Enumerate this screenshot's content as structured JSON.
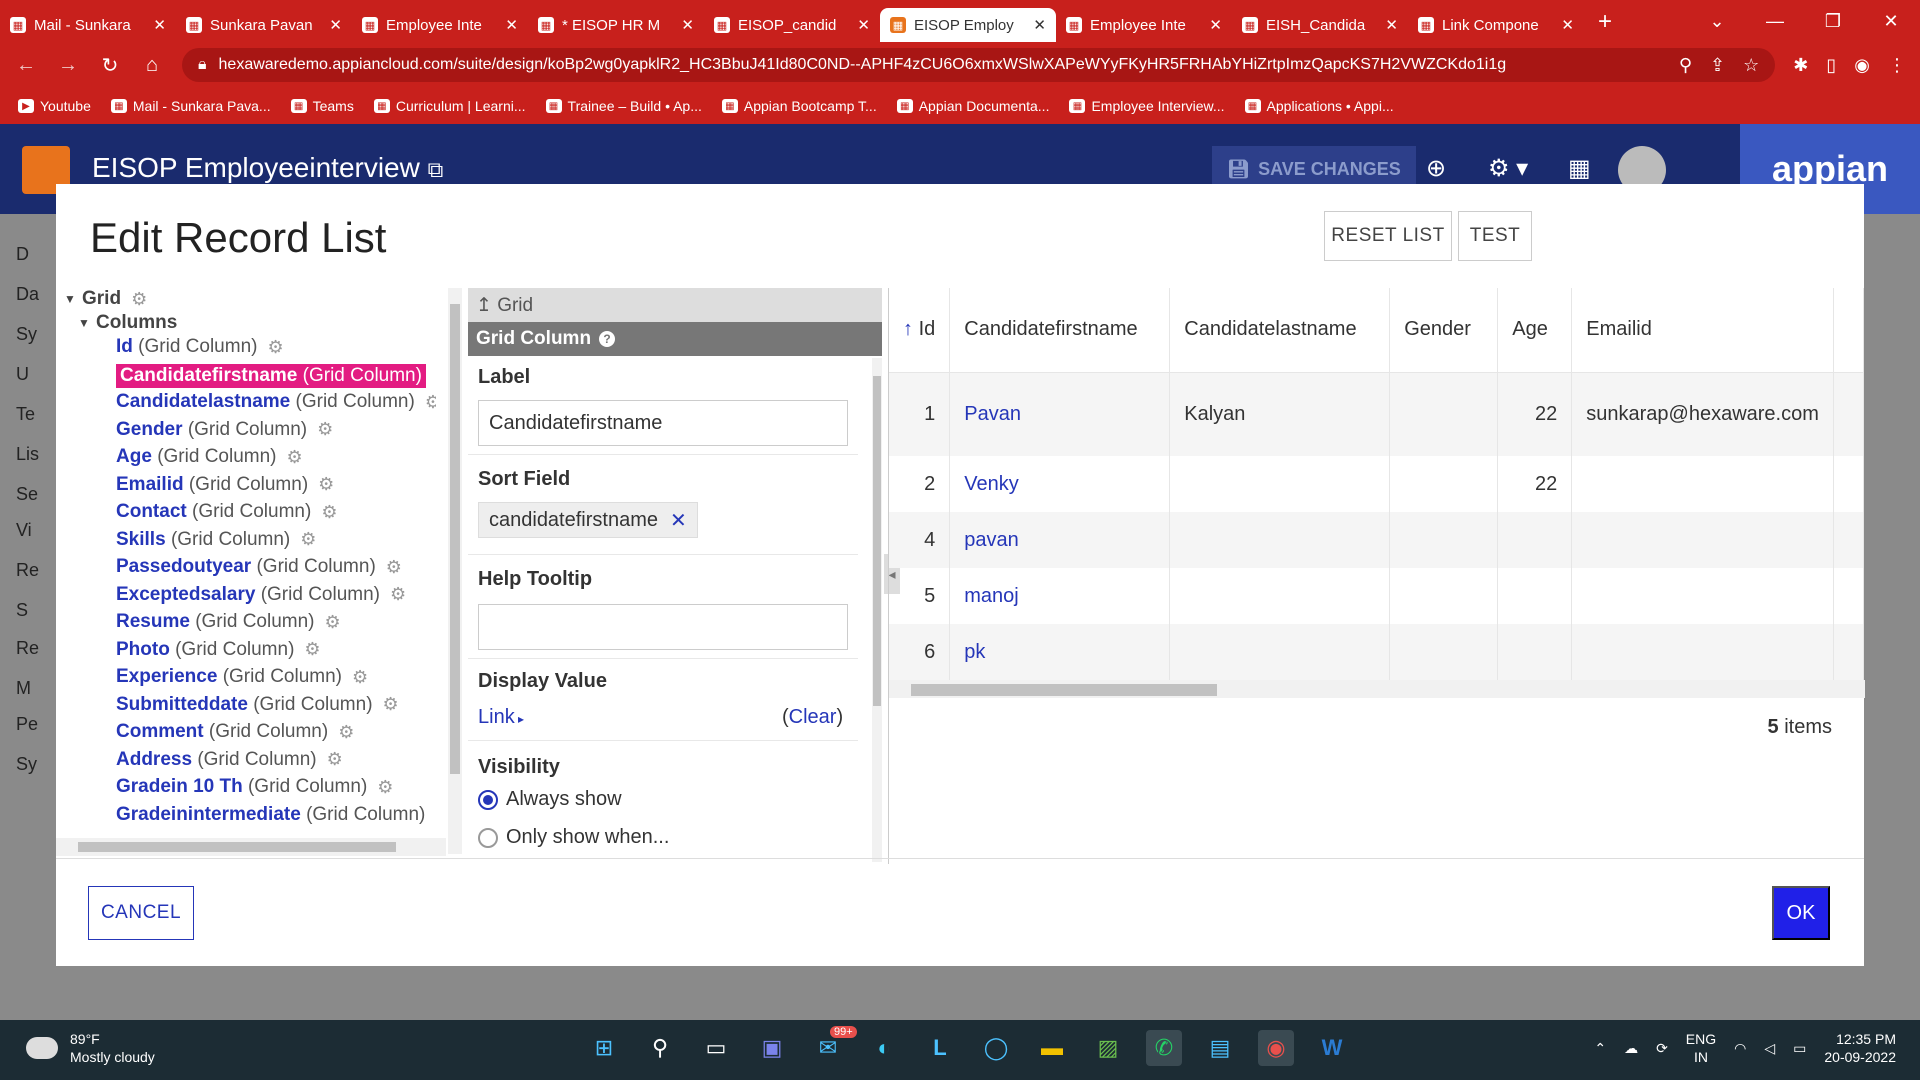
{
  "browser": {
    "tabs": [
      {
        "label": "Mail - Sunkara",
        "icon": "outlook-icon",
        "active": false
      },
      {
        "label": "Sunkara Pavan",
        "icon": "teams-icon",
        "active": false
      },
      {
        "label": "Employee Inte",
        "icon": "appian-grid-icon",
        "active": false
      },
      {
        "label": "* EISOP HR M",
        "icon": "appian-form-icon",
        "active": false
      },
      {
        "label": "EISOP_candid",
        "icon": "appian-record-icon",
        "active": false
      },
      {
        "label": "EISOP Employ",
        "icon": "appian-app-icon",
        "active": true
      },
      {
        "label": "Employee Inte",
        "icon": "appian-grid-icon",
        "active": false
      },
      {
        "label": "EISH_Candida",
        "icon": "appian-record-icon",
        "active": false
      },
      {
        "label": "Link Compone",
        "icon": "appian-doc-icon",
        "active": false
      }
    ],
    "url": "hexawaredemo.appiancloud.com/suite/design/koBp2wg0yapklR2_HC3BbuJ41Id80C0ND--APHF4zCU6O6xmxWSlwXAPeWYyFKyHR5FRHAbYHiZrtpImzQapcKS7H2VWZCKdo1i1g",
    "bookmarks": [
      {
        "label": "Youtube"
      },
      {
        "label": "Mail - Sunkara Pava..."
      },
      {
        "label": "Teams"
      },
      {
        "label": "Curriculum | Learni..."
      },
      {
        "label": "Trainee – Build • Ap..."
      },
      {
        "label": "Appian Bootcamp T..."
      },
      {
        "label": "Appian Documenta..."
      },
      {
        "label": "Employee Interview..."
      },
      {
        "label": "Applications • Appi..."
      }
    ]
  },
  "app": {
    "title": "EISOP Employeeinterview",
    "save_label": "SAVE CHANGES",
    "brand": "appian"
  },
  "background_sidebar": [
    "D",
    "Da",
    "Sy",
    "U",
    "Te",
    "Lis",
    "Se",
    "Vi",
    "Re",
    "S",
    "Re",
    "M",
    "Pe",
    "Sy"
  ],
  "modal": {
    "title": "Edit Record List",
    "reset_label": "RESET LIST",
    "test_label": "TEST",
    "cancel_label": "CANCEL",
    "ok_label": "OK"
  },
  "tree": {
    "root": "Grid",
    "columns_label": "Columns",
    "type_suffix": "(Grid Column)",
    "items": [
      {
        "name": "Id"
      },
      {
        "name": "Candidatefirstname",
        "selected": true
      },
      {
        "name": "Candidatelastname"
      },
      {
        "name": "Gender"
      },
      {
        "name": "Age"
      },
      {
        "name": "Emailid"
      },
      {
        "name": "Contact"
      },
      {
        "name": "Skills"
      },
      {
        "name": "Passedoutyear"
      },
      {
        "name": "Exceptedsalary"
      },
      {
        "name": "Resume"
      },
      {
        "name": "Photo"
      },
      {
        "name": "Experience"
      },
      {
        "name": "Submitteddate"
      },
      {
        "name": "Comment"
      },
      {
        "name": "Address"
      },
      {
        "name": "Gradein 10 Th"
      },
      {
        "name": "Gradeinintermediate"
      }
    ]
  },
  "config": {
    "breadcrumb": "Grid",
    "header": "Grid Column",
    "label_title": "Label",
    "label_value": "Candidatefirstname",
    "sort_title": "Sort Field",
    "sort_value": "candidatefirstname",
    "tooltip_title": "Help Tooltip",
    "tooltip_value": "",
    "display_title": "Display Value",
    "display_link": "Link",
    "clear_label": "Clear",
    "visibility_title": "Visibility",
    "vis_always": "Always show",
    "vis_only": "Only show when..."
  },
  "grid": {
    "headers": [
      "Id",
      "Candidatefirstname",
      "Candidatelastname",
      "Gender",
      "Age",
      "Emailid"
    ],
    "rows": [
      {
        "id": "1",
        "first": "Pavan",
        "last": "Kalyan",
        "gender": "",
        "age": "22",
        "email": "sunkarap@hexaware.com"
      },
      {
        "id": "2",
        "first": "Venky",
        "last": "",
        "gender": "",
        "age": "22",
        "email": ""
      },
      {
        "id": "4",
        "first": "pavan",
        "last": "",
        "gender": "",
        "age": "",
        "email": ""
      },
      {
        "id": "5",
        "first": "manoj",
        "last": "",
        "gender": "",
        "age": "",
        "email": ""
      },
      {
        "id": "6",
        "first": "pk",
        "last": "",
        "gender": "",
        "age": "",
        "email": ""
      }
    ],
    "count_num": "5",
    "count_label": "items"
  },
  "taskbar": {
    "temp": "89°F",
    "weather": "Mostly cloudy",
    "mail_badge": "99+",
    "lang1": "ENG",
    "lang2": "IN",
    "time": "12:35 PM",
    "date": "20-09-2022"
  }
}
